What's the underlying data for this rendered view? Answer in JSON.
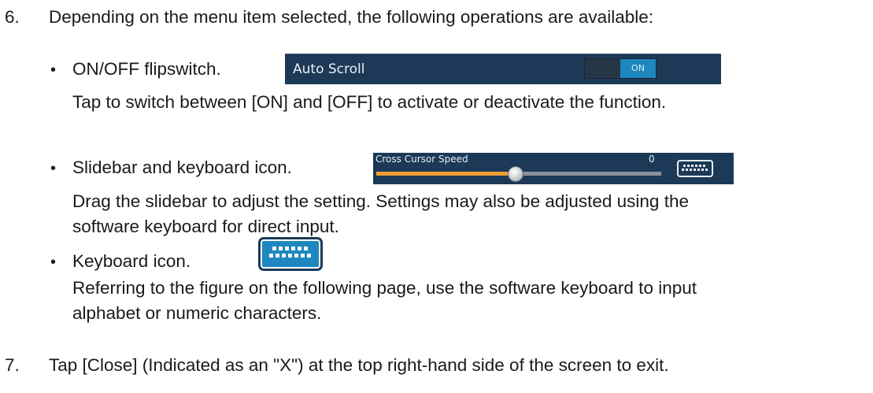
{
  "step6": {
    "number": "6.",
    "text": "Depending on the menu item selected, the following operations are available:"
  },
  "item_flip": {
    "bullet": "•",
    "title": "ON/OFF flipswitch.",
    "desc": "Tap to switch between [ON] and [OFF] to activate or deactivate the function.",
    "panel_label": "Auto Scroll",
    "switch_on_label": "ON",
    "colors": {
      "panel_bg": "#1c3a58",
      "on_bg": "#1e87bf"
    }
  },
  "item_slide": {
    "bullet": "•",
    "title": "Slidebar and keyboard icon.",
    "desc_line1": "Drag the slidebar to adjust the setting. Settings may also be adjusted using the",
    "desc_line2": "software keyboard for direct input.",
    "panel_label": "Cross Cursor Speed",
    "panel_value": "0",
    "slider_fraction": 0.49,
    "keyboard_icon": "keyboard-icon",
    "colors": {
      "fill": "#f0a030",
      "track": "#8a9199"
    }
  },
  "item_kbd": {
    "bullet": "•",
    "title": "Keyboard icon.",
    "desc_line1": "Referring to the figure on the following page, use the software keyboard to input",
    "desc_line2": "alphabet or numeric characters.",
    "keyboard_icon": "keyboard-icon",
    "colors": {
      "icon_bg": "#1e87bf"
    }
  },
  "step7": {
    "number": "7.",
    "text": "Tap [Close] (Indicated as an \"X\") at the top right-hand side of the screen to exit."
  }
}
